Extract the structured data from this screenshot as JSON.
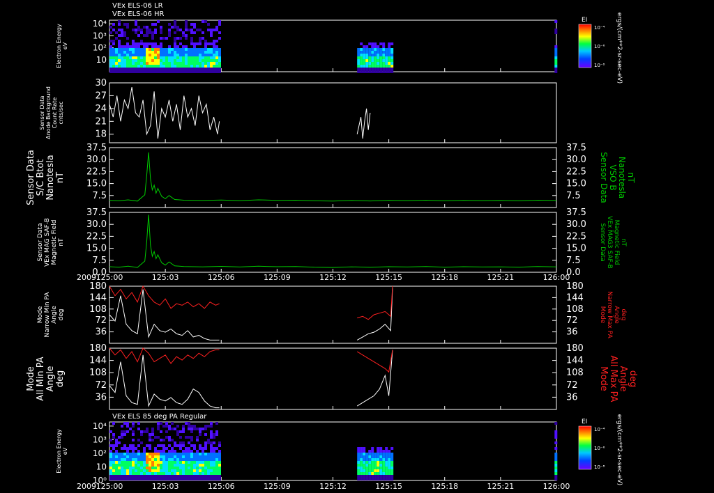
{
  "chart_data": [
    {
      "id": "p1",
      "type": "heatmap",
      "titles": [
        "VEx ELS-06 LR",
        "VEx ELS-06 HR"
      ],
      "ylabel": [
        "Electron Energy",
        "eV"
      ],
      "yscale": "log",
      "ylim": [
        1,
        20000
      ],
      "y_ticks": [
        10,
        100,
        1000,
        10000
      ],
      "y_tick_labels": [
        "10",
        "10²",
        "10³",
        "10⁴"
      ],
      "colorbar": {
        "label": "EI",
        "ticks": [
          "10⁻⁴",
          "10⁻⁶",
          "10⁻⁸"
        ]
      },
      "units_label": "ergs/(cm**2-sr-sec-eV)",
      "data_intervals": [
        [
          0.0,
          5.9
        ],
        [
          13.3,
          15.2
        ],
        [
          23.9,
          24.0
        ]
      ]
    },
    {
      "id": "p2",
      "type": "line",
      "ylabel": [
        "Sensor Data",
        "Anode Background",
        "Count Rate",
        "cnts/sec"
      ],
      "ylim": [
        16,
        30
      ],
      "y_ticks": [
        18,
        21,
        24,
        27,
        30
      ],
      "series": [
        {
          "color": "#ffffff",
          "x": [
            0.0,
            0.2,
            0.4,
            0.6,
            0.8,
            1.0,
            1.2,
            1.4,
            1.6,
            1.8,
            2.0,
            2.2,
            2.4,
            2.6,
            2.8,
            3.0,
            3.2,
            3.4,
            3.6,
            3.8,
            4.0,
            4.2,
            4.4,
            4.6,
            4.8,
            5.0,
            5.2,
            5.4,
            5.6,
            5.8,
            5.9
          ],
          "y": [
            25,
            22,
            27,
            21,
            26,
            24,
            29,
            23,
            22,
            26,
            18,
            20,
            28,
            17,
            24,
            22,
            26,
            21,
            25,
            19,
            27,
            22,
            24,
            20,
            27,
            23,
            25,
            19,
            22,
            18,
            21
          ]
        },
        {
          "color": "#ffffff",
          "x": [
            13.3,
            13.4,
            13.5,
            13.6,
            13.7,
            13.8,
            13.9,
            14.0
          ],
          "y": [
            18,
            20,
            22,
            17,
            21,
            24,
            19,
            23
          ]
        }
      ]
    },
    {
      "id": "p3",
      "type": "line",
      "ylabel": [
        "Sensor Data",
        "S/C Btot",
        "Nanotesla",
        "nT"
      ],
      "ylabel_right": [
        "Sensor Data",
        "VSO B",
        "Nanotesla",
        "nT"
      ],
      "ylim": [
        0,
        37.5
      ],
      "y_ticks": [
        7.5,
        15.0,
        22.5,
        30.0,
        37.5
      ],
      "y_tick_labels": [
        "7.5",
        "15.0",
        "22.5",
        "30.0",
        "37.5"
      ],
      "series": [
        {
          "color": "#00cc00",
          "x": [
            0,
            0.5,
            1.0,
            1.5,
            1.9,
            2.0,
            2.1,
            2.2,
            2.3,
            2.4,
            2.5,
            2.6,
            2.8,
            3.0,
            3.2,
            3.5,
            4,
            5,
            6,
            7,
            8,
            9,
            10,
            11,
            12,
            13,
            14,
            15,
            16,
            17,
            18,
            19,
            20,
            21,
            22,
            23,
            24
          ],
          "y": [
            4.5,
            4.2,
            4.8,
            4.0,
            8.0,
            20.0,
            34.5,
            18.0,
            11.0,
            14.0,
            9.0,
            12.0,
            7.0,
            5.5,
            7.5,
            5.0,
            4.6,
            4.4,
            4.7,
            4.3,
            4.8,
            4.5,
            4.6,
            4.2,
            4.0,
            4.4,
            4.1,
            4.5,
            4.3,
            4.6,
            4.2,
            4.5,
            4.3,
            4.4,
            4.2,
            4.6,
            4.4
          ]
        }
      ]
    },
    {
      "id": "p4",
      "type": "line",
      "ylabel": [
        "Sensor Data",
        "VEx MAG SAF-B",
        "Magnetic Field",
        "nT"
      ],
      "ylabel_right": [
        "Sensor Data",
        "VEx MAG3 SAF-B",
        "Magnetic Field",
        "nT"
      ],
      "ylim": [
        0,
        37.5
      ],
      "y_ticks": [
        0.0,
        7.5,
        15.0,
        22.5,
        30.0,
        37.5
      ],
      "y_tick_labels": [
        "0.0",
        "7.5",
        "15.0",
        "22.5",
        "30.0",
        "37.5"
      ],
      "series": [
        {
          "color": "#00cc00",
          "x": [
            0,
            0.5,
            1.0,
            1.5,
            1.9,
            2.0,
            2.1,
            2.2,
            2.3,
            2.4,
            2.5,
            2.6,
            2.8,
            3.0,
            3.2,
            3.5,
            4,
            5,
            6,
            7,
            8,
            9,
            10,
            11,
            12,
            13,
            14,
            15,
            16,
            17,
            18,
            19,
            20,
            21,
            22,
            23,
            24
          ],
          "y": [
            3.5,
            3.2,
            3.8,
            3.0,
            7.0,
            19.0,
            36.0,
            17.0,
            10.0,
            13.0,
            8.5,
            11.0,
            6.0,
            4.5,
            6.5,
            4.0,
            3.6,
            3.4,
            3.7,
            3.3,
            3.8,
            3.5,
            3.6,
            3.2,
            3.0,
            3.4,
            3.1,
            3.5,
            3.3,
            3.6,
            3.2,
            3.5,
            3.3,
            3.4,
            3.2,
            3.6,
            3.4
          ]
        }
      ]
    },
    {
      "id": "p5",
      "type": "line",
      "ylabel": [
        "Mode",
        "Narrow Min PA",
        "Angle",
        "deg"
      ],
      "ylabel_right": [
        "Mode",
        "Narrow Max PA",
        "Angle",
        "deg"
      ],
      "ylim": [
        0,
        180
      ],
      "y_ticks": [
        36,
        72,
        108,
        144,
        180
      ],
      "series": [
        {
          "color": "#ffffff",
          "x": [
            0,
            0.3,
            0.6,
            0.9,
            1.2,
            1.5,
            1.8,
            2.1,
            2.4,
            2.7,
            3.0,
            3.3,
            3.6,
            3.9,
            4.2,
            4.5,
            4.8,
            5.1,
            5.4,
            5.7,
            5.9
          ],
          "y": [
            90,
            70,
            150,
            60,
            40,
            30,
            170,
            20,
            60,
            40,
            35,
            45,
            30,
            25,
            40,
            20,
            25,
            15,
            10,
            10,
            10
          ]
        },
        {
          "color": "#ff2020",
          "x": [
            0,
            0.3,
            0.6,
            0.9,
            1.2,
            1.5,
            1.8,
            2.1,
            2.4,
            2.7,
            3.0,
            3.3,
            3.6,
            3.9,
            4.2,
            4.5,
            4.8,
            5.1,
            5.4,
            5.7,
            5.9
          ],
          "y": [
            180,
            150,
            170,
            140,
            160,
            130,
            180,
            150,
            130,
            120,
            140,
            110,
            125,
            120,
            130,
            115,
            125,
            110,
            130,
            120,
            125
          ]
        },
        {
          "color": "#ffffff",
          "x": [
            13.3,
            13.6,
            13.9,
            14.2,
            14.5,
            14.8,
            15.1,
            15.2
          ],
          "y": [
            10,
            20,
            30,
            35,
            45,
            60,
            40,
            175
          ]
        },
        {
          "color": "#ff2020",
          "x": [
            13.3,
            13.6,
            13.9,
            14.2,
            14.5,
            14.8,
            15.1,
            15.2
          ],
          "y": [
            80,
            85,
            75,
            90,
            95,
            100,
            85,
            180
          ]
        }
      ]
    },
    {
      "id": "p6",
      "type": "line",
      "ylabel": [
        "Mode",
        "All Min PA",
        "Angle",
        "deg"
      ],
      "ylabel_right": [
        "Mode",
        "All Max PA",
        "Angle",
        "deg"
      ],
      "ylim": [
        0,
        180
      ],
      "y_ticks": [
        36,
        72,
        108,
        144,
        180
      ],
      "series": [
        {
          "color": "#ffffff",
          "x": [
            0,
            0.3,
            0.6,
            0.9,
            1.2,
            1.5,
            1.8,
            2.1,
            2.4,
            2.7,
            3.0,
            3.3,
            3.6,
            3.9,
            4.2,
            4.5,
            4.8,
            5.1,
            5.4,
            5.7,
            5.9
          ],
          "y": [
            70,
            50,
            140,
            40,
            20,
            15,
            160,
            10,
            45,
            30,
            25,
            35,
            20,
            15,
            30,
            60,
            50,
            25,
            10,
            5,
            5
          ]
        },
        {
          "color": "#ff2020",
          "x": [
            0,
            0.3,
            0.6,
            0.9,
            1.2,
            1.5,
            1.8,
            2.1,
            2.4,
            2.7,
            3.0,
            3.3,
            3.6,
            3.9,
            4.2,
            4.5,
            4.8,
            5.1,
            5.4,
            5.7,
            5.9
          ],
          "y": [
            180,
            160,
            175,
            150,
            170,
            140,
            180,
            165,
            140,
            150,
            160,
            135,
            155,
            145,
            160,
            150,
            165,
            155,
            170,
            175,
            175
          ]
        },
        {
          "color": "#ffffff",
          "x": [
            13.3,
            13.6,
            13.9,
            14.2,
            14.5,
            14.8,
            15.0,
            15.2
          ],
          "y": [
            10,
            20,
            30,
            40,
            60,
            100,
            40,
            175
          ]
        },
        {
          "color": "#ff2020",
          "x": [
            13.3,
            13.6,
            13.9,
            14.2,
            14.5,
            14.8,
            15.0,
            15.2
          ],
          "y": [
            170,
            160,
            150,
            140,
            130,
            120,
            110,
            175
          ]
        }
      ]
    },
    {
      "id": "p7",
      "type": "heatmap",
      "titles": [
        "VEx ELS 85 deg PA Regular"
      ],
      "ylabel": [
        "Electron Energy",
        "eV"
      ],
      "yscale": "log",
      "ylim": [
        1,
        20000
      ],
      "y_ticks": [
        1,
        10,
        100,
        1000,
        10000
      ],
      "y_tick_labels": [
        "10⁰",
        "10",
        "10²",
        "10³",
        "10⁴"
      ],
      "colorbar": {
        "label": "EI",
        "ticks": [
          "10⁻⁴",
          "10⁻⁶",
          "10⁻⁸"
        ]
      },
      "units_label": "ergs/(cm**2-sr-sec-eV)",
      "data_intervals": [
        [
          0.0,
          5.9
        ],
        [
          13.3,
          15.2
        ],
        [
          23.9,
          24.0
        ]
      ]
    }
  ],
  "time_axis": {
    "xlim": [
      0,
      24
    ],
    "ticks": [
      0,
      3,
      6,
      9,
      12,
      15,
      18,
      21,
      24
    ],
    "tick_labels": [
      "125:00",
      "125:03",
      "125:06",
      "125:09",
      "125:12",
      "125:15",
      "125:18",
      "125:21",
      "126:00"
    ],
    "year_label": "2009"
  },
  "colors": {
    "frame": "#ffffff",
    "green": "#00cc00",
    "red": "#ff2020"
  }
}
